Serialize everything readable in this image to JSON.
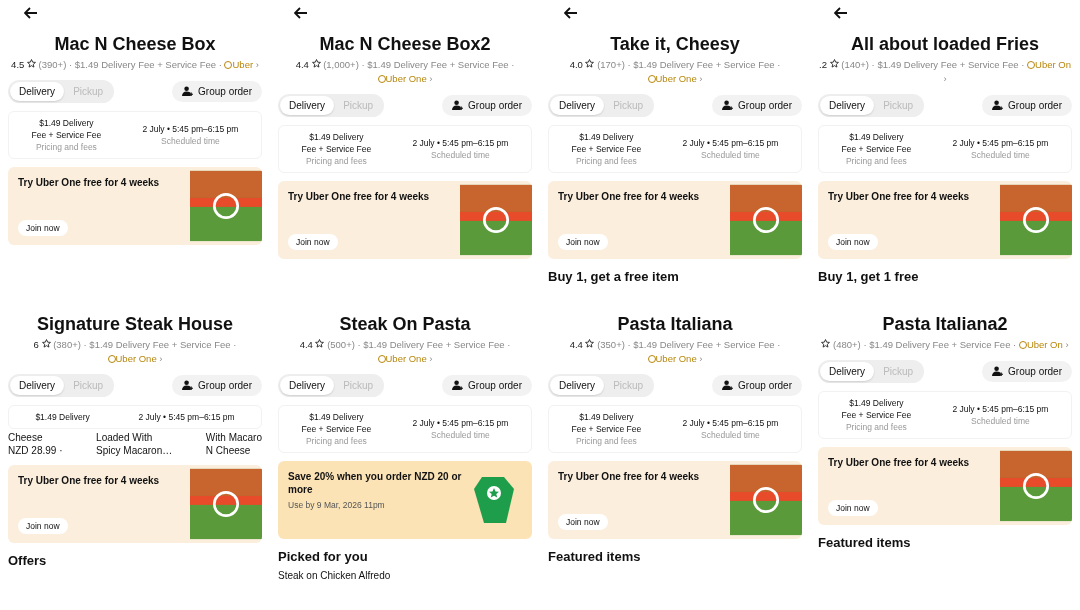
{
  "panels": [
    {
      "back_button": true,
      "title": "Mac N Cheese Box",
      "meta": {
        "rating": "4.5",
        "count": "(390+)",
        "fee": "· $1.49 Delivery Fee + Service Fee ·",
        "badge": "Uber",
        "chevron": "›"
      },
      "modes": [
        {
          "label": "Delivery",
          "selected": true
        },
        {
          "label": "Pickup",
          "selected": false
        }
      ],
      "group_order": "Group order",
      "info": {
        "fee_lines": [
          "$1.49 Delivery",
          "Fee + Service Fee"
        ],
        "fee_caption": "Pricing and fees",
        "time": "2 July • 5:45 pm–6:15 pm",
        "time_caption": "Scheduled time"
      },
      "promo": {
        "kind": "membership",
        "title": "Try Uber One free for 4 weeks",
        "action": "Join now"
      }
    },
    {
      "back_button": true,
      "title": "Mac N Cheese Box2",
      "meta": {
        "rating": "4.4",
        "count": "(1,000+)",
        "fee": "· $1.49 Delivery Fee + Service Fee ·",
        "badge": "Uber One",
        "chevron": "›"
      },
      "modes": [
        {
          "label": "Delivery",
          "selected": true
        },
        {
          "label": "Pickup",
          "selected": false
        }
      ],
      "group_order": "Group order",
      "info": {
        "fee_lines": [
          "$1.49 Delivery",
          "Fee + Service Fee"
        ],
        "fee_caption": "Pricing and fees",
        "time": "2 July • 5:45 pm–6:15 pm",
        "time_caption": "Scheduled time"
      },
      "promo": {
        "kind": "membership",
        "title": "Try Uber One free for 4 weeks",
        "action": "Join now"
      }
    },
    {
      "back_button": true,
      "title": "Take it, Cheesy",
      "meta": {
        "rating": "4.0",
        "count": "(170+)",
        "fee": "· $1.49 Delivery Fee + Service Fee ·",
        "badge": "Uber One",
        "chevron": "›"
      },
      "modes": [
        {
          "label": "Delivery",
          "selected": true
        },
        {
          "label": "Pickup",
          "selected": false
        }
      ],
      "group_order": "Group order",
      "info": {
        "fee_lines": [
          "$1.49 Delivery",
          "Fee + Service Fee"
        ],
        "fee_caption": "Pricing and fees",
        "time": "2 July • 5:45 pm–6:15 pm",
        "time_caption": "Scheduled time"
      },
      "promo": {
        "kind": "membership",
        "title": "Try Uber One free for 4 weeks",
        "action": "Join now"
      },
      "section": "Buy 1, get a free item"
    },
    {
      "back_button": true,
      "title": "All about loaded Fries",
      "meta": {
        "rating": ".2",
        "count": "(140+)",
        "fee": "· $1.49 Delivery Fee + Service Fee ·",
        "badge": "Uber On",
        "chevron": "›"
      },
      "modes": [
        {
          "label": "Delivery",
          "selected": true
        },
        {
          "label": "Pickup",
          "selected": false
        }
      ],
      "group_order": "Group order",
      "info": {
        "fee_lines": [
          "$1.49 Delivery",
          "Fee + Service Fee"
        ],
        "fee_caption": "Pricing and fees",
        "time": "2 July • 5:45 pm–6:15 pm",
        "time_caption": "Scheduled time"
      },
      "promo": {
        "kind": "membership",
        "title": "Try Uber One free for 4 weeks",
        "action": "Join now"
      },
      "section": "Buy 1, get 1 free"
    },
    {
      "back_button": false,
      "title": "Signature Steak House",
      "meta": {
        "rating": "6",
        "count": "(380+)",
        "fee": "· $1.49 Delivery Fee + Service Fee ·",
        "badge": "Uber One",
        "chevron": "›"
      },
      "modes": [
        {
          "label": "Delivery",
          "selected": true
        },
        {
          "label": "Pickup",
          "selected": false
        }
      ],
      "group_order": "Group order",
      "info": {
        "fee_lines": [
          "$1.49 Delivery"
        ],
        "time": "2 July • 5:45 pm–6:15 pm"
      },
      "peek_items": [
        {
          "lines": [
            "Cheese",
            "NZD 28.99 ·"
          ]
        },
        {
          "lines": [
            "Loaded With",
            "Spicy Macaron…"
          ]
        },
        {
          "lines": [
            "With Macaro",
            "N Cheese"
          ]
        }
      ],
      "promo": {
        "kind": "membership",
        "title": "Try Uber One free for 4 weeks",
        "action": "Join now"
      },
      "section": "Offers"
    },
    {
      "back_button": false,
      "title": "Steak On Pasta",
      "meta": {
        "rating": "4.4",
        "count": "(500+)",
        "fee": "· $1.49 Delivery Fee + Service Fee ·",
        "badge": "Uber One",
        "chevron": "›"
      },
      "modes": [
        {
          "label": "Delivery",
          "selected": true
        },
        {
          "label": "Pickup",
          "selected": false
        }
      ],
      "group_order": "Group order",
      "info": {
        "fee_lines": [
          "$1.49 Delivery",
          "Fee + Service Fee"
        ],
        "fee_caption": "Pricing and fees",
        "time": "2 July • 5:45 pm–6:15 pm",
        "time_caption": "Scheduled time"
      },
      "promo": {
        "kind": "offer",
        "title": "Save 20% when you order NZD 20 or more",
        "subtitle": "Use by 9 Mar, 2026 11pm"
      },
      "section": "Picked for you",
      "item": "Steak on Chicken Alfredo"
    },
    {
      "back_button": false,
      "title": "Pasta Italiana",
      "meta": {
        "rating": "4.4",
        "count": "(350+)",
        "fee": "· $1.49 Delivery Fee + Service Fee ·",
        "badge": "Uber One",
        "chevron": "›"
      },
      "modes": [
        {
          "label": "Delivery",
          "selected": true
        },
        {
          "label": "Pickup",
          "selected": false
        }
      ],
      "group_order": "Group order",
      "info": {
        "fee_lines": [
          "$1.49 Delivery",
          "Fee + Service Fee"
        ],
        "fee_caption": "Pricing and fees",
        "time": "2 July • 5:45 pm–6:15 pm",
        "time_caption": "Scheduled time"
      },
      "promo": {
        "kind": "membership",
        "title": "Try Uber One free for 4 weeks",
        "action": "Join now"
      },
      "section": "Featured items"
    },
    {
      "back_button": false,
      "title": "Pasta Italiana2",
      "meta": {
        "count": "(480+)",
        "fee": "· $1.49 Delivery Fee + Service Fee ·",
        "badge": "Uber On",
        "chevron": "›"
      },
      "modes": [
        {
          "label": "Delivery",
          "selected": true
        },
        {
          "label": "Pickup",
          "selected": false
        }
      ],
      "group_order": "Group order",
      "info": {
        "fee_lines": [
          "$1.49 Delivery",
          "Fee + Service Fee"
        ],
        "fee_caption": "Pricing and fees",
        "time": "2 July • 5:45 pm–6:15 pm",
        "time_caption": "Scheduled time"
      },
      "promo": {
        "kind": "membership",
        "title": "Try Uber One free for 4 weeks",
        "action": "Join now"
      },
      "section": "Featured items"
    }
  ]
}
